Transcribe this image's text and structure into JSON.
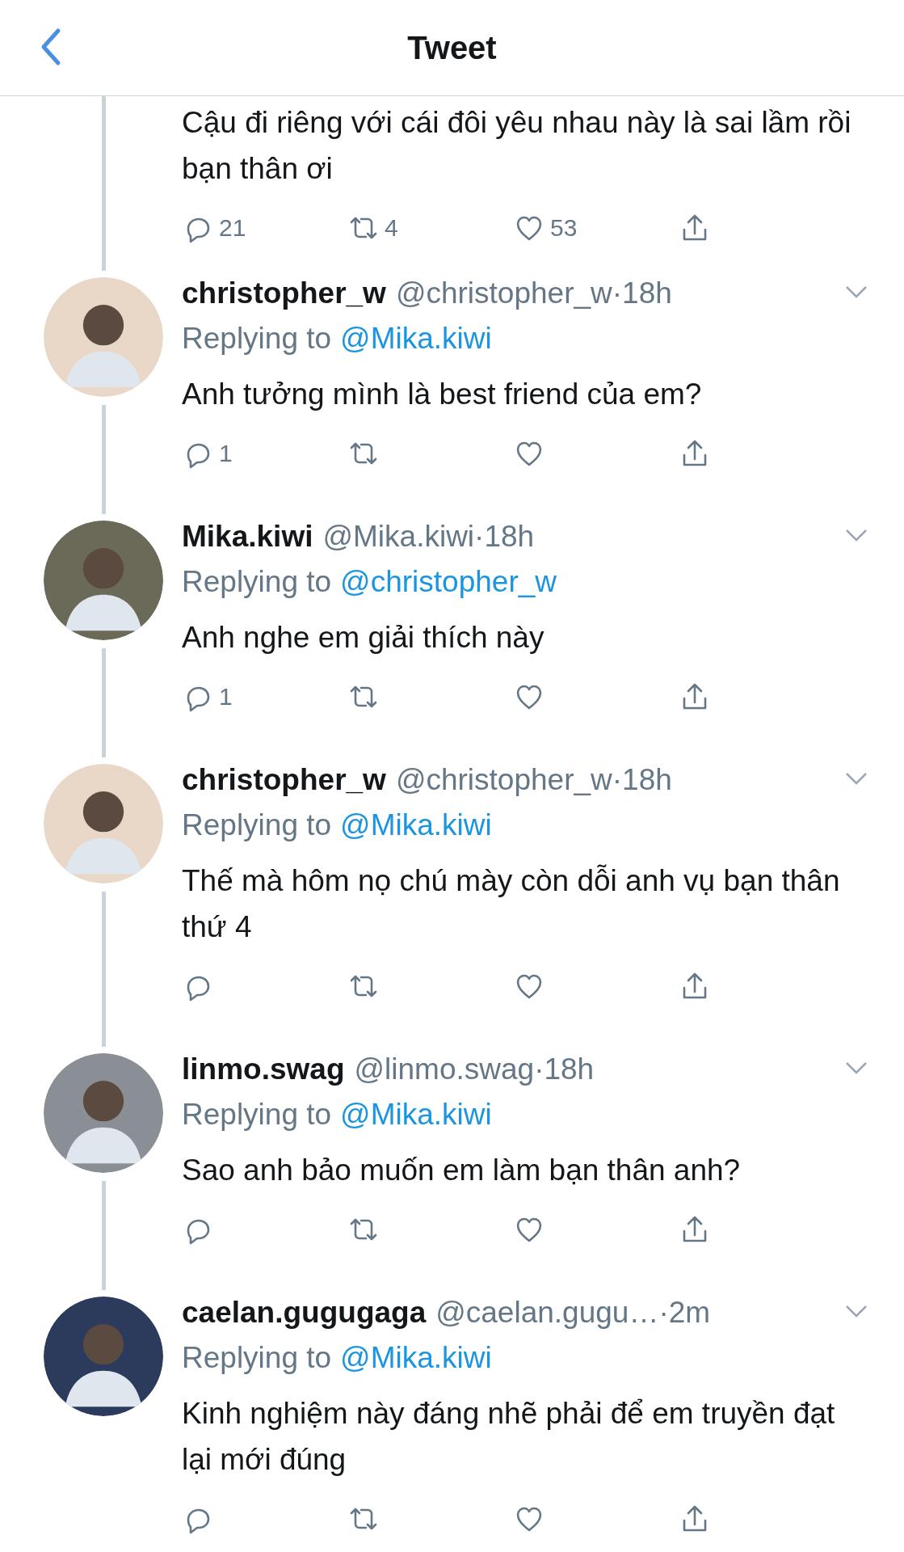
{
  "header": {
    "title": "Tweet"
  },
  "tweets": [
    {
      "kind": "partial",
      "text": "Cậu đi riêng với cái đôi yêu nhau này là sai lầm rồi bạn thân ơi",
      "replies": "21",
      "retweets": "4",
      "likes": "53"
    },
    {
      "kind": "reply",
      "name": "christopher_w",
      "handle": "@christopher_w",
      "time": "·18h",
      "replying_label": "Replying to",
      "replying_to": "@Mika.kiwi",
      "text": "Anh tưởng mình là best friend của em?",
      "replies": "1"
    },
    {
      "kind": "reply",
      "name": "Mika.kiwi",
      "handle": "@Mika.kiwi",
      "time": "·18h",
      "replying_label": "Replying to",
      "replying_to": "@christopher_w",
      "text": "Anh nghe em giải thích này",
      "replies": "1"
    },
    {
      "kind": "reply",
      "name": "christopher_w",
      "handle": "@christopher_w",
      "time": "·18h",
      "replying_label": "Replying to",
      "replying_to": "@Mika.kiwi",
      "text": "Thế mà hôm nọ chú mày còn dỗi anh vụ bạn thân thứ 4"
    },
    {
      "kind": "reply",
      "name": "linmo.swag",
      "handle": "@linmo.swag",
      "time": "·18h",
      "replying_label": "Replying to",
      "replying_to": "@Mika.kiwi",
      "text": "Sao anh bảo muốn em làm bạn thân anh?"
    },
    {
      "kind": "reply",
      "name": "caelan.gugugaga",
      "handle": "@caelan.gugu…",
      "time": "·2m",
      "replying_label": "Replying to",
      "replying_to": "@Mika.kiwi",
      "text": "Kinh nghiệm này đáng nhẽ phải để em truyền đạt lại mới đúng"
    }
  ]
}
